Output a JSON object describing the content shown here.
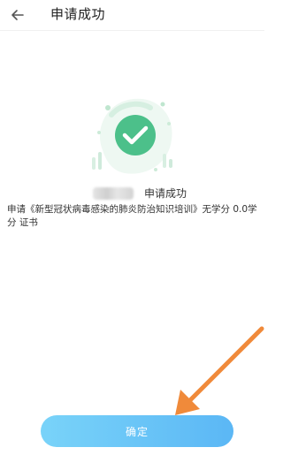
{
  "header": {
    "back_icon": "arrow-left-icon",
    "title": "申请成功"
  },
  "result": {
    "icon": "check-circle-icon",
    "status": "申请成功",
    "description_line1": "申请《新型冠状病毒感染的肺炎防治知识培训》无学分 0.0学",
    "description_line2": "分 证书"
  },
  "actions": {
    "confirm_label": "确定"
  },
  "colors": {
    "accent_green": "#4cc08a",
    "button_gradient_start": "#79d3f9",
    "button_gradient_end": "#5bb7f5",
    "annotation_arrow": "#f08a3a"
  }
}
